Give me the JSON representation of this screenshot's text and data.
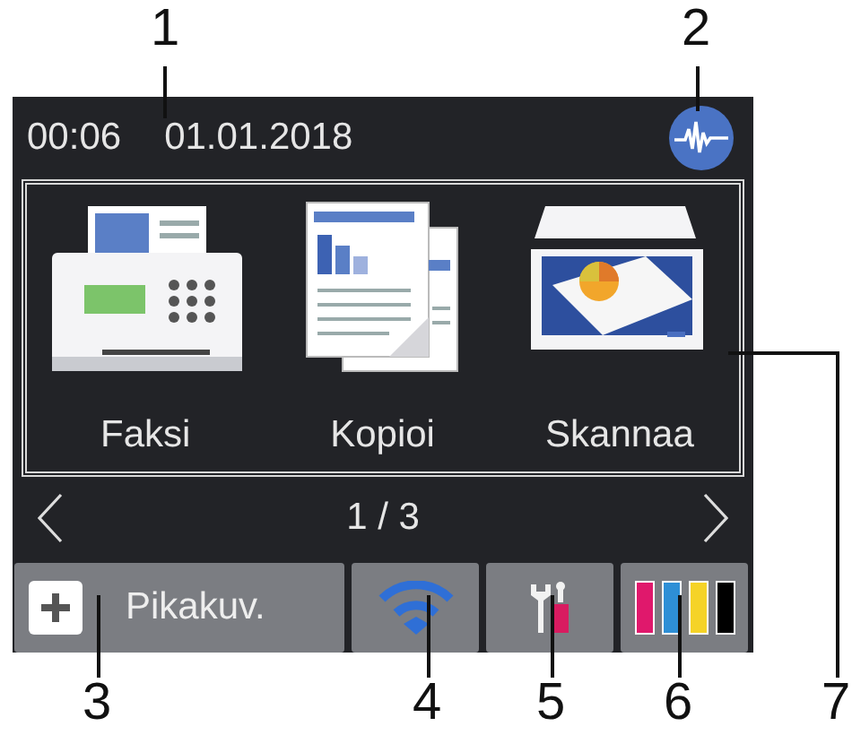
{
  "status_bar": {
    "time": "00:06",
    "date": "01.01.2018"
  },
  "tiles": [
    {
      "kind": "fax",
      "label": "Faksi"
    },
    {
      "kind": "copy",
      "label": "Kopioi"
    },
    {
      "kind": "scan",
      "label": "Skannaa"
    }
  ],
  "pager": {
    "text": "1 / 3"
  },
  "bottom_bar": {
    "shortcut_label": "Pikakuv.",
    "inks": [
      {
        "color": "#e0186c"
      },
      {
        "color": "#2e8fd6"
      },
      {
        "color": "#f5d327"
      },
      {
        "color": "#000000"
      }
    ]
  },
  "callouts": [
    {
      "label": "1"
    },
    {
      "label": "2"
    },
    {
      "label": "3"
    },
    {
      "label": "4"
    },
    {
      "label": "5"
    },
    {
      "label": "6"
    },
    {
      "label": "7"
    }
  ]
}
